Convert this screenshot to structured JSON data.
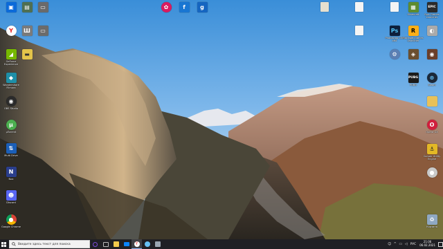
{
  "desktop": {
    "left_column": [
      {
        "name": "unlabeled",
        "label": "",
        "color": "#0b6ad9"
      },
      {
        "name": "yandex",
        "label": "",
        "color": "#e62020"
      },
      {
        "name": "geforce",
        "label": "GeForce Experience",
        "color": "#76b900"
      },
      {
        "name": "wondershare",
        "label": "Wondershare Filmora",
        "color": "#1e8fa8"
      },
      {
        "name": "obs",
        "label": "OBS Studio",
        "color": "#2b2b2b"
      },
      {
        "name": "utorrent",
        "label": "µTorrent",
        "color": "#4caf50"
      },
      {
        "name": "multidrive",
        "label": "Multi Drive",
        "color": "#1b5fb8"
      },
      {
        "name": "nox",
        "label": "Nox",
        "color": "#2a3e8c"
      },
      {
        "name": "discord",
        "label": "Discord",
        "color": "#5865f2"
      },
      {
        "name": "chrome",
        "label": "Google Chrome",
        "color": "#db4437"
      }
    ],
    "second_column": [
      {
        "name": "unknown-a",
        "label": "",
        "color": "#4f6f52"
      },
      {
        "name": "unknown-b",
        "label": "",
        "color": "#6a6a6a"
      },
      {
        "name": "unknown-c",
        "label": "",
        "color": "#7a7a7a"
      },
      {
        "name": "unknown-d",
        "label": "",
        "color": "#6b6b6b"
      },
      {
        "name": "unknown-e",
        "label": "",
        "color": "#e3c44a"
      }
    ],
    "top_center": [
      {
        "name": "game",
        "label": "",
        "color": "#d81b60"
      },
      {
        "name": "app-f",
        "label": "",
        "color": "#1976d2"
      },
      {
        "name": "garrys-mod",
        "label": "",
        "color": "#1565c0"
      }
    ],
    "right_files": [
      {
        "name": "file-1",
        "label": "",
        "color": "#e6e0cf"
      },
      {
        "name": "file-2",
        "label": "",
        "color": "#f4f4f4"
      },
      {
        "name": "file-3",
        "label": "",
        "color": "#f4f4f4"
      }
    ],
    "right_column_a": [
      {
        "name": "file-4",
        "label": "",
        "color": "#f4f4f4"
      },
      {
        "name": "photoshop",
        "label": "Photoshop CS6 x64",
        "color": "#0d1f3c"
      },
      {
        "name": "valorant",
        "label": "",
        "color": "#5a7fb4"
      },
      {
        "name": "pubg",
        "label": "PUBG",
        "color": "#1a1a1a"
      }
    ],
    "right_column_b": [
      {
        "name": "minecraft",
        "label": "Minecraft",
        "color": "#5d8c2f"
      },
      {
        "name": "rockstar",
        "label": "Rockstar Games Launcher",
        "color": "#fcaf17"
      },
      {
        "name": "game-b",
        "label": "",
        "color": "#6b4f2f"
      },
      {
        "name": "steam",
        "label": "Steam",
        "color": "#1b2838"
      }
    ],
    "right_column_c": [
      {
        "name": "epic",
        "label": "Epic Games Launcher",
        "color": "#2a2a2a"
      },
      {
        "name": "app-c",
        "label": "",
        "color": "#aaaaaa"
      },
      {
        "name": "game-c",
        "label": "",
        "color": "#6b3f2a"
      },
      {
        "name": "folder",
        "label": "",
        "color": "#e8c15a"
      },
      {
        "name": "opera",
        "label": "Opera GX",
        "color": "#d11f3d"
      },
      {
        "name": "corsair",
        "label": "Corsair Utility Engine",
        "color": "#e3b826"
      },
      {
        "name": "app-d",
        "label": "",
        "color": "#c9c9c9"
      },
      {
        "name": "recycle",
        "label": "Корзина",
        "color": "#8fa8c2"
      }
    ]
  },
  "taskbar": {
    "search_placeholder": "Введите здесь текст для поиска",
    "pinned": [
      {
        "name": "cortana",
        "color": "#7d4cdb"
      },
      {
        "name": "task-view",
        "color": "#888888"
      },
      {
        "name": "explorer",
        "color": "#f2c94c"
      },
      {
        "name": "mail",
        "color": "#0a84ff"
      },
      {
        "name": "yandex-browser",
        "color": "#e62020",
        "active": true
      },
      {
        "name": "steam",
        "color": "#66c0f4"
      },
      {
        "name": "app",
        "color": "#9aa5b1"
      }
    ],
    "tray": {
      "language": "РУС",
      "time": "21:06",
      "date": "06.02.2021"
    }
  }
}
